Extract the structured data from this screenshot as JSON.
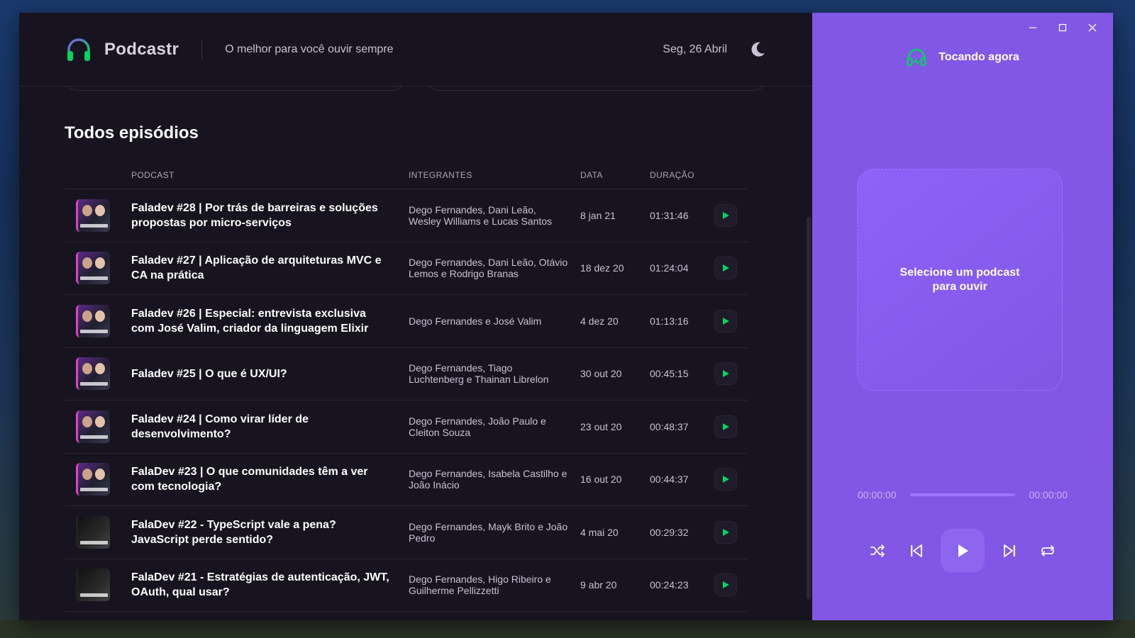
{
  "app": {
    "brand": "Podcastr",
    "tagline": "O melhor para você ouvir sempre",
    "date": "Seg, 26 Abril"
  },
  "section_title": "Todos episódios",
  "table": {
    "headers": [
      "PODCAST",
      "INTEGRANTES",
      "DATA",
      "DURAÇÃO"
    ],
    "rows": [
      {
        "title": "Faladev #28 | Por trás de barreiras e soluções propostas por micro-serviços",
        "members": "Dego Fernandes, Dani Leão, Wesley Williams e Lucas Santos",
        "date": "8 jan 21",
        "duration": "01:31:46"
      },
      {
        "title": "Faladev #27 | Aplicação de arquiteturas MVC e CA na prática",
        "members": "Dego Fernandes, Dani Leão, Otávio Lemos e Rodrigo Branas",
        "date": "18 dez 20",
        "duration": "01:24:04"
      },
      {
        "title": "Faladev #26 | Especial: entrevista exclusiva com José Valim, criador da linguagem Elixir",
        "members": "Dego Fernandes e José Valim",
        "date": "4 dez 20",
        "duration": "01:13:16"
      },
      {
        "title": "Faladev #25 | O que é UX/UI?",
        "members": "Dego Fernandes, Tiago Luchtenberg e Thainan Librelon",
        "date": "30 out 20",
        "duration": "00:45:15"
      },
      {
        "title": "Faladev #24 | Como virar líder de desenvolvimento?",
        "members": "Dego Fernandes, João Paulo e Cleiton Souza",
        "date": "23 out 20",
        "duration": "00:48:37"
      },
      {
        "title": "FalaDev #23 | O que comunidades têm a ver com tecnologia?",
        "members": "Dego Fernandes, Isabela Castilho e João Inácio",
        "date": "16 out 20",
        "duration": "00:44:37"
      },
      {
        "title": "FalaDev #22 - TypeScript vale a pena? JavaScript perde sentido?",
        "members": "Dego Fernandes, Mayk Brito e João Pedro",
        "date": "4 mai 20",
        "duration": "00:29:32"
      },
      {
        "title": "FalaDev #21 - Estratégias de autenticação, JWT, OAuth, qual usar?",
        "members": "Dego Fernandes, Higo Ribeiro e Guilherme Pellizzetti",
        "date": "9 abr 20",
        "duration": "00:24:23"
      }
    ]
  },
  "player": {
    "title": "Tocando agora",
    "empty_message": "Selecione um podcast para ouvir",
    "time_start": "00:00:00",
    "time_end": "00:00:00"
  },
  "colors": {
    "accent_purple": "#8257e5",
    "play_green": "#04d361",
    "bg_dark": "#17141f"
  }
}
